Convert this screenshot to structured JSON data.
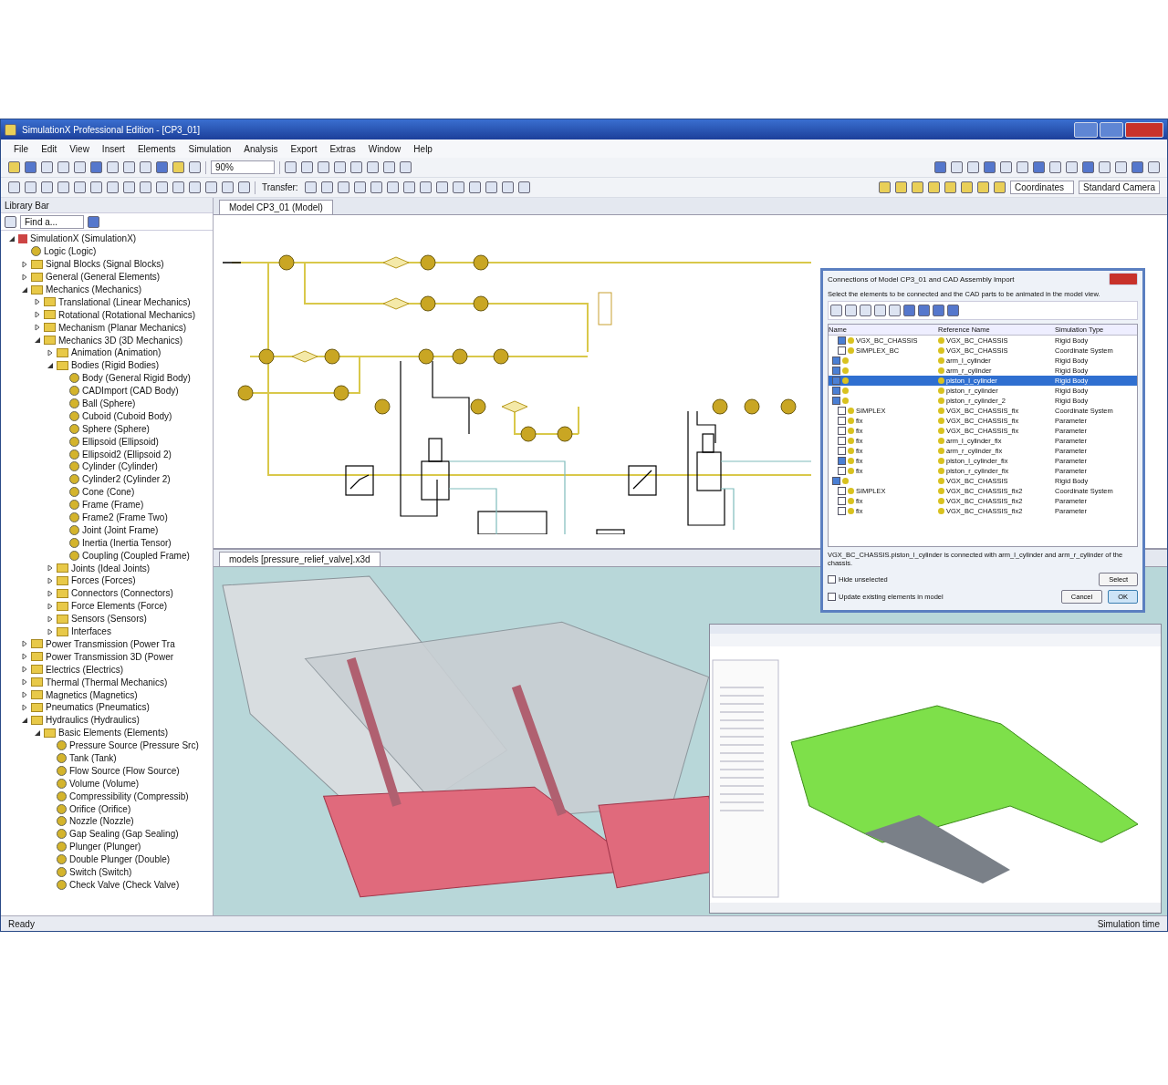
{
  "window": {
    "title": "SimulationX Professional Edition - [CP3_01]"
  },
  "menu": [
    "File",
    "Edit",
    "View",
    "Insert",
    "Elements",
    "Simulation",
    "Analysis",
    "Export",
    "Extras",
    "Window",
    "Help"
  ],
  "toolbar": {
    "zoom": "90%",
    "transfer": "Transfer:",
    "coordinates": "Coordinates",
    "camera": "Standard Camera"
  },
  "library": {
    "title": "Library Bar",
    "filter": "Find a...",
    "tree": [
      {
        "label": "SimulationX (SimulationX)",
        "kind": "library",
        "expanded": true,
        "children": [
          {
            "label": "Logic (Logic)",
            "kind": "element"
          },
          {
            "label": "Signal Blocks (Signal Blocks)",
            "kind": "folder",
            "expanded": false
          },
          {
            "label": "General (General Elements)",
            "kind": "folder",
            "expanded": false
          },
          {
            "label": "Mechanics (Mechanics)",
            "kind": "folder",
            "expanded": true,
            "children": [
              {
                "label": "Translational (Linear Mechanics)",
                "kind": "folder",
                "expanded": false
              },
              {
                "label": "Rotational (Rotational Mechanics)",
                "kind": "folder",
                "expanded": false
              },
              {
                "label": "Mechanism (Planar Mechanics)",
                "kind": "folder",
                "expanded": false
              },
              {
                "label": "Mechanics 3D (3D Mechanics)",
                "kind": "folder",
                "expanded": true,
                "children": [
                  {
                    "label": "Animation (Animation)",
                    "kind": "folder",
                    "expanded": false
                  },
                  {
                    "label": "Bodies (Rigid Bodies)",
                    "kind": "folder",
                    "expanded": true,
                    "children": [
                      {
                        "label": "Body (General Rigid Body)",
                        "kind": "element"
                      },
                      {
                        "label": "CADImport (CAD Body)",
                        "kind": "element"
                      },
                      {
                        "label": "Ball (Sphere)",
                        "kind": "element"
                      },
                      {
                        "label": "Cuboid (Cuboid Body)",
                        "kind": "element"
                      },
                      {
                        "label": "Sphere (Sphere)",
                        "kind": "element"
                      },
                      {
                        "label": "Ellipsoid (Ellipsoid)",
                        "kind": "element"
                      },
                      {
                        "label": "Ellipsoid2 (Ellipsoid 2)",
                        "kind": "element"
                      },
                      {
                        "label": "Cylinder (Cylinder)",
                        "kind": "element"
                      },
                      {
                        "label": "Cylinder2 (Cylinder 2)",
                        "kind": "element"
                      },
                      {
                        "label": "Cone (Cone)",
                        "kind": "element"
                      },
                      {
                        "label": "Frame (Frame)",
                        "kind": "element"
                      },
                      {
                        "label": "Frame2 (Frame Two)",
                        "kind": "element"
                      },
                      {
                        "label": "Joint (Joint Frame)",
                        "kind": "element"
                      },
                      {
                        "label": "Inertia (Inertia Tensor)",
                        "kind": "element"
                      },
                      {
                        "label": "Coupling (Coupled Frame)",
                        "kind": "element"
                      }
                    ]
                  },
                  {
                    "label": "Joints (Ideal Joints)",
                    "kind": "folder",
                    "expanded": false
                  },
                  {
                    "label": "Forces (Forces)",
                    "kind": "folder",
                    "expanded": false
                  },
                  {
                    "label": "Connectors (Connectors)",
                    "kind": "folder",
                    "expanded": false
                  },
                  {
                    "label": "Force Elements (Force)",
                    "kind": "folder",
                    "expanded": false
                  },
                  {
                    "label": "Sensors (Sensors)",
                    "kind": "folder",
                    "expanded": false
                  },
                  {
                    "label": "Interfaces",
                    "kind": "folder",
                    "expanded": false
                  }
                ]
              }
            ]
          },
          {
            "label": "Power Transmission (Power Tra",
            "kind": "folder",
            "expanded": false
          },
          {
            "label": "Power Transmission 3D (Power",
            "kind": "folder",
            "expanded": false
          },
          {
            "label": "Electrics (Electrics)",
            "kind": "folder",
            "expanded": false
          },
          {
            "label": "Thermal (Thermal Mechanics)",
            "kind": "folder",
            "expanded": false
          },
          {
            "label": "Magnetics (Magnetics)",
            "kind": "folder",
            "expanded": false
          },
          {
            "label": "Pneumatics (Pneumatics)",
            "kind": "folder",
            "expanded": false
          },
          {
            "label": "Hydraulics (Hydraulics)",
            "kind": "folder",
            "expanded": true,
            "children": [
              {
                "label": "Basic Elements (Elements)",
                "kind": "folder",
                "expanded": true,
                "children": [
                  {
                    "label": "Pressure Source (Pressure Src)",
                    "kind": "element"
                  },
                  {
                    "label": "Tank (Tank)",
                    "kind": "element"
                  },
                  {
                    "label": "Flow Source (Flow Source)",
                    "kind": "element"
                  },
                  {
                    "label": "Volume (Volume)",
                    "kind": "element"
                  },
                  {
                    "label": "Compressibility (Compressib)",
                    "kind": "element"
                  },
                  {
                    "label": "Orifice (Orifice)",
                    "kind": "element"
                  },
                  {
                    "label": "Nozzle (Nozzle)",
                    "kind": "element"
                  },
                  {
                    "label": "Gap Sealing (Gap Sealing)",
                    "kind": "element"
                  },
                  {
                    "label": "Plunger (Plunger)",
                    "kind": "element"
                  },
                  {
                    "label": "Double Plunger (Double)",
                    "kind": "element"
                  },
                  {
                    "label": "Switch (Switch)",
                    "kind": "element"
                  },
                  {
                    "label": "Check Valve (Check Valve)",
                    "kind": "element"
                  }
                ]
              }
            ]
          }
        ]
      }
    ]
  },
  "schematic": {
    "tab": "Model CP3_01 (Model)"
  },
  "view3d": {
    "tab": "models [pressure_relief_valve].x3d"
  },
  "dialog": {
    "title": "Connections of Model CP3_01 and CAD Assembly Import",
    "hint": "Select the elements to be connected and the CAD parts to be animated in the model view.",
    "columns": [
      "Name",
      "Reference Name",
      "Simulation Type"
    ],
    "rows": [
      {
        "name": "VGX_BC_CHASSIS",
        "ref": "VGX_BC_CHASSIS",
        "type": "Rigid Body",
        "checked": true,
        "selected": false
      },
      {
        "name": "SIMPLEX_BC",
        "ref": "VGX_BC_CHASSIS",
        "type": "Coordinate System",
        "checked": false,
        "selected": false
      },
      {
        "name": "",
        "ref": "arm_l_cylinder",
        "type": "Rigid Body",
        "checked": true,
        "selected": false
      },
      {
        "name": "",
        "ref": "arm_r_cylinder",
        "type": "Rigid Body",
        "checked": true,
        "selected": false
      },
      {
        "name": "",
        "ref": "piston_l_cylinder",
        "type": "Rigid Body",
        "checked": true,
        "selected": true
      },
      {
        "name": "",
        "ref": "piston_r_cylinder",
        "type": "Rigid Body",
        "checked": true,
        "selected": false
      },
      {
        "name": "",
        "ref": "piston_r_cylinder_2",
        "type": "Rigid Body",
        "checked": true,
        "selected": false
      },
      {
        "name": "SIMPLEX",
        "ref": "VGX_BC_CHASSIS_fix",
        "type": "Coordinate System",
        "checked": false,
        "selected": false
      },
      {
        "name": "fix",
        "ref": "VGX_BC_CHASSIS_fix",
        "type": "Parameter",
        "checked": false,
        "selected": false
      },
      {
        "name": "fix",
        "ref": "VGX_BC_CHASSIS_fix",
        "type": "Parameter",
        "checked": false,
        "selected": false
      },
      {
        "name": "fix",
        "ref": "arm_l_cylinder_fix",
        "type": "Parameter",
        "checked": false,
        "selected": false
      },
      {
        "name": "fix",
        "ref": "arm_r_cylinder_fix",
        "type": "Parameter",
        "checked": false,
        "selected": false
      },
      {
        "name": "fix",
        "ref": "piston_l_cylinder_fix",
        "type": "Parameter",
        "checked": true,
        "selected": false
      },
      {
        "name": "fix",
        "ref": "piston_r_cylinder_fix",
        "type": "Parameter",
        "checked": false,
        "selected": false
      },
      {
        "name": "",
        "ref": "VGX_BC_CHASSIS",
        "type": "Rigid Body",
        "checked": true,
        "selected": false
      },
      {
        "name": "SIMPLEX",
        "ref": "VGX_BC_CHASSIS_fix2",
        "type": "Coordinate System",
        "checked": false,
        "selected": false
      },
      {
        "name": "fix",
        "ref": "VGX_BC_CHASSIS_fix2",
        "type": "Parameter",
        "checked": false,
        "selected": false
      },
      {
        "name": "fix",
        "ref": "VGX_BC_CHASSIS_fix2",
        "type": "Parameter",
        "checked": false,
        "selected": false
      }
    ],
    "footer": "VGX_BC_CHASSIS.piston_l_cylinder is connected with arm_l_cylinder and arm_r_cylinder of the chassis.",
    "options": [
      {
        "label": "Hide unselected",
        "checked": false
      },
      {
        "label": "Update existing elements in model",
        "checked": false
      }
    ],
    "buttons": [
      {
        "label": "Select",
        "kind": "normal"
      },
      {
        "label": "Cancel",
        "kind": "normal"
      },
      {
        "label": "OK",
        "kind": "default"
      }
    ]
  },
  "status_bar": {
    "left": "Ready",
    "right": "Simulation time"
  }
}
